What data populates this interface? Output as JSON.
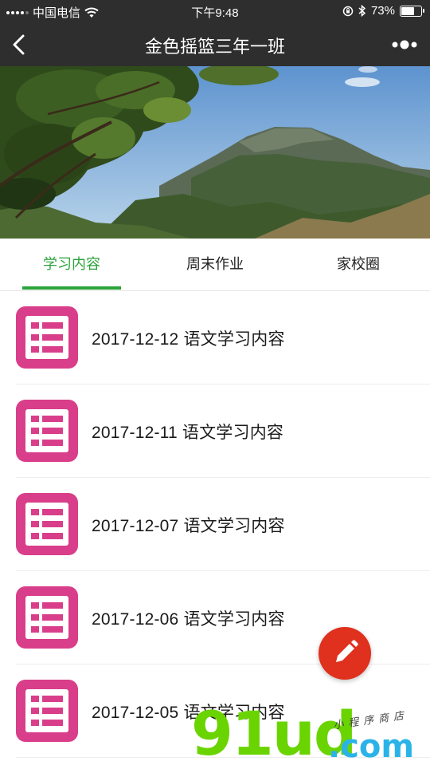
{
  "status_bar": {
    "carrier": "中国电信",
    "time": "下午9:48",
    "battery": "73%",
    "battery_level": 0.73,
    "icons": [
      "signal-icon",
      "wifi-icon",
      "orientation-lock-icon",
      "bluetooth-icon",
      "battery-icon"
    ]
  },
  "nav": {
    "title": "金色摇篮三年一班",
    "back_icon": "back-arrow-icon",
    "more_icon": "more-dots-icon"
  },
  "banner": {
    "page_count": 1,
    "current_page": 1
  },
  "tabs": [
    {
      "label": "学习内容",
      "active": true
    },
    {
      "label": "周末作业",
      "active": false
    },
    {
      "label": "家校圈",
      "active": false
    }
  ],
  "colors": {
    "accent": "#2aa339",
    "icon_pink": "#d93e8a",
    "fab_red": "#e0301e",
    "header": "#2e2e2e"
  },
  "list": {
    "items": [
      {
        "title": "2017-12-12 语文学习内容",
        "icon": "list-document-icon"
      },
      {
        "title": "2017-12-11 语文学习内容",
        "icon": "list-document-icon"
      },
      {
        "title": "2017-12-07 语文学习内容",
        "icon": "list-document-icon"
      },
      {
        "title": "2017-12-06 语文学习内容",
        "icon": "list-document-icon"
      },
      {
        "title": "2017-12-05 语文学习内容",
        "icon": "list-document-icon"
      }
    ]
  },
  "fab": {
    "icon": "pencil-icon"
  },
  "watermark": {
    "brand": "91ud",
    "domain": ".com",
    "tagline": "小程序商店"
  }
}
